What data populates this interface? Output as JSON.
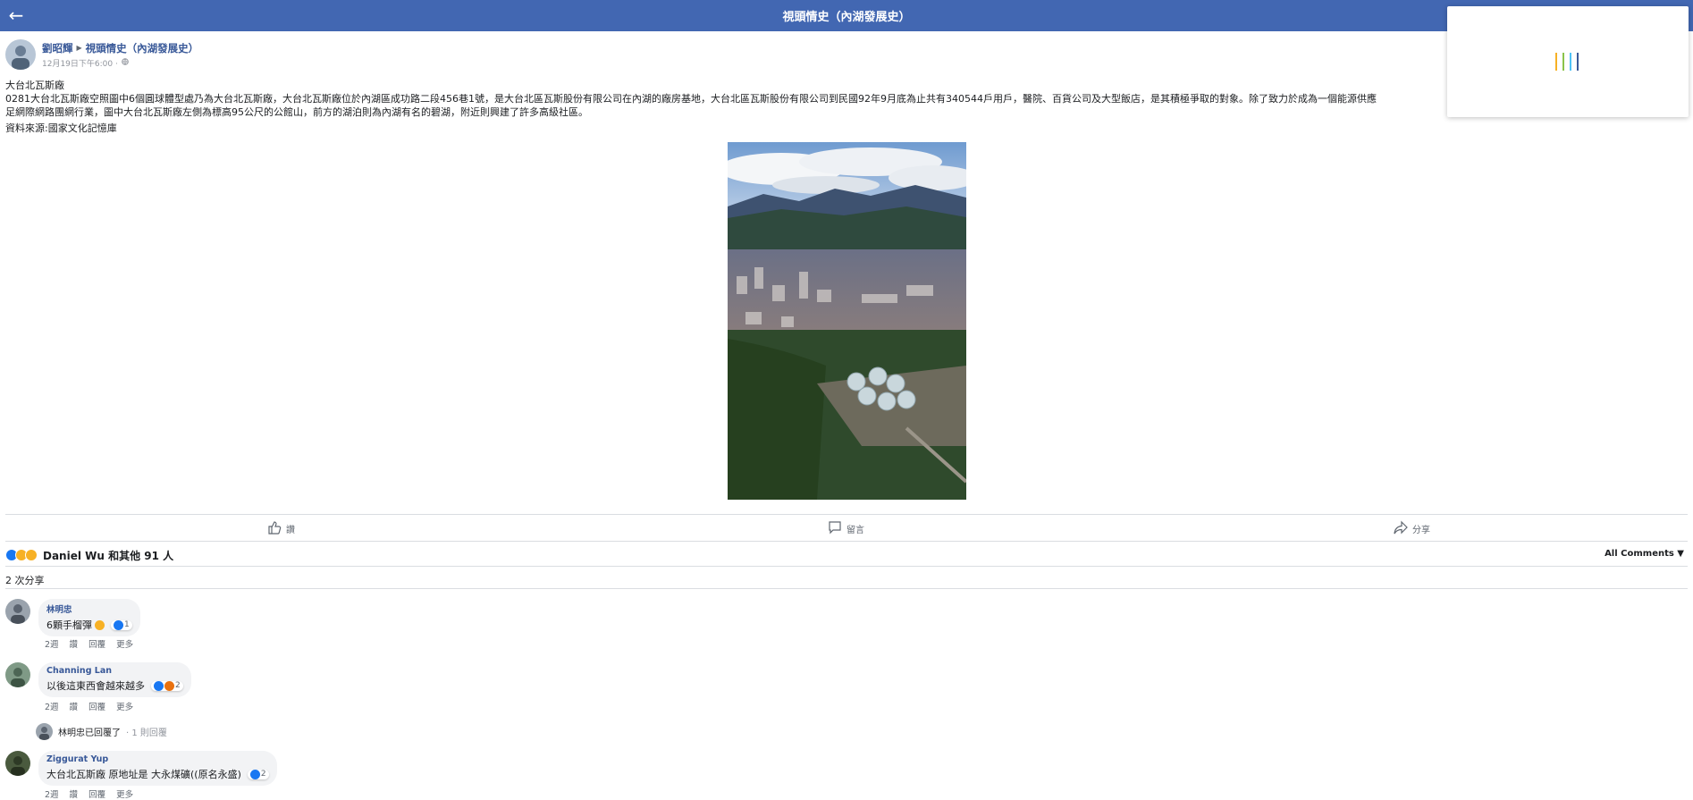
{
  "header": {
    "title": "視頭情史（內湖發展史）",
    "back_icon": "arrow-left-icon",
    "color": "#4267b2"
  },
  "post": {
    "author": "劉昭輝",
    "group": "視頭情史（內湖發展史）",
    "timestamp": "12月19日下午6:00 · ",
    "title_line": "大台北瓦斯廠",
    "line1": "0281大台北瓦斯廠空照圖中6個圓球體型處乃為大台北瓦斯廠，大台北瓦斯廠位於內湖區成功路二段456巷1號，是大台北區瓦斯股份有限公司在內湖的廠房基地，大台北區瓦斯股份有限公司到民國92年9月底為止共有340544戶用戶，醫院、百貨公司及大型飯店，是其積極爭取的對象。除了致力於成為一個能源供應",
    "line2": "足網際網路團網行業，圖中大台北瓦斯廠左側為標高95公尺的公館山，前方的湖泊則為內湖有名的碧湖，附近則興建了許多高級社區。",
    "source": "資料來源:國家文化記憶庫"
  },
  "actions": {
    "like": "讚",
    "comment": "留言",
    "share": "分享"
  },
  "reactions": {
    "summary": "Daniel Wu 和其他 91 人",
    "filter": "All Comments ▼",
    "shares": "2 次分享"
  },
  "comments": [
    {
      "name": "林明忠",
      "text": "6顆手榴彈",
      "react_count": "1",
      "time": "2週",
      "like": "讚",
      "reply": "回覆",
      "more": "更多"
    },
    {
      "name": "Channing Lan",
      "text": "以後這東西會越來越多",
      "react_count": "2",
      "time": "2週",
      "like": "讚",
      "reply": "回覆",
      "more": "更多"
    },
    {
      "name": "Ziggurat Yup",
      "text": "大台北瓦斯廠 原地址是 大永煤礦((原名永盛)",
      "react_count": "2",
      "time": "2週",
      "like": "讚",
      "reply": "回覆",
      "more": "更多"
    }
  ],
  "replies": {
    "author": "林明忠已回覆了",
    "count": "· 1 則回覆"
  },
  "colors": {
    "link": "#385898",
    "muted": "#606770",
    "like_blue": "#1877f2",
    "haha_yellow": "#f7b125"
  }
}
